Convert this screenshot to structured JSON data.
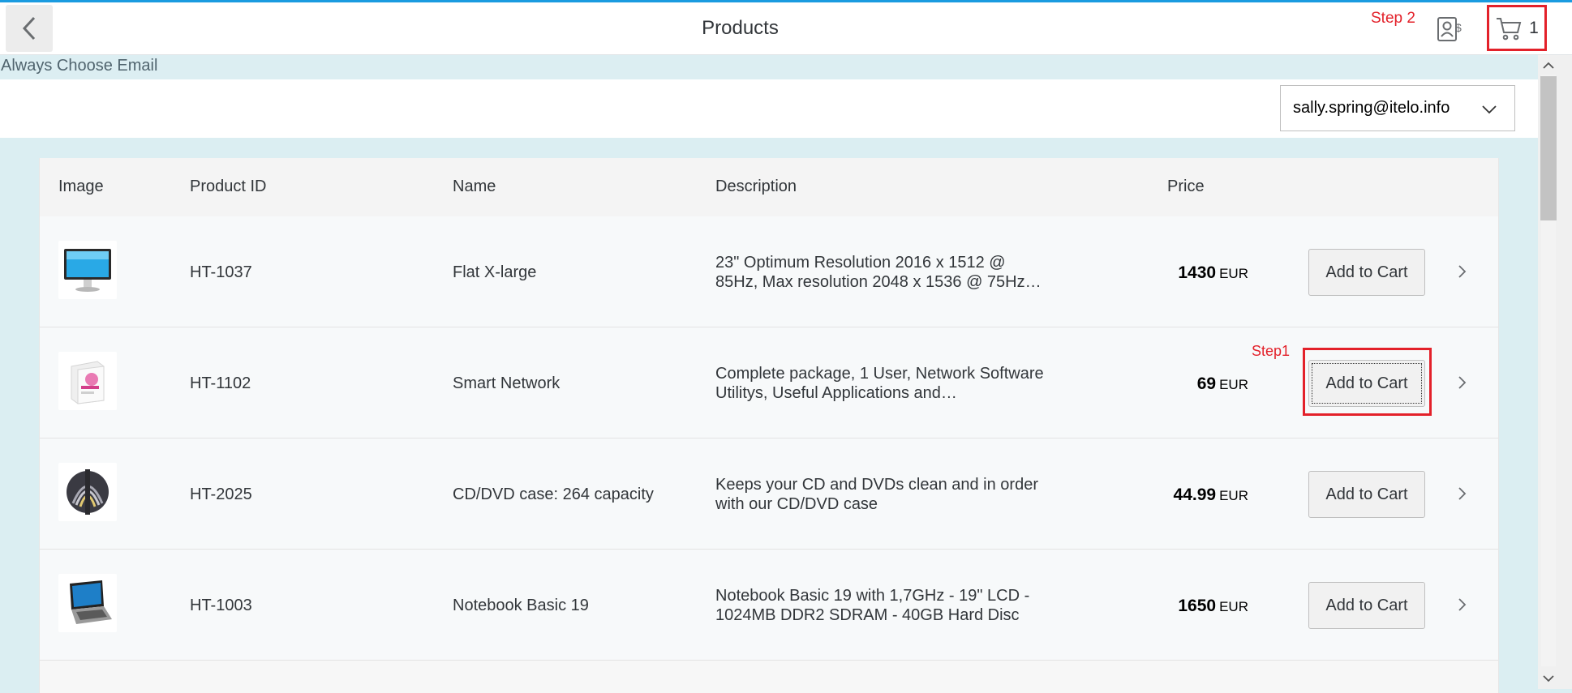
{
  "header": {
    "title": "Products",
    "cart_count": "1",
    "step2_label": "Step 2"
  },
  "subheader": {
    "text": "Always Choose Email"
  },
  "email_select": {
    "value": "sally.spring@itelo.info"
  },
  "table": {
    "columns": [
      "Image",
      "Product ID",
      "Name",
      "Description",
      "Price"
    ],
    "rows": [
      {
        "id": "HT-1037",
        "name": "Flat X-large",
        "desc_line1": "23\" Optimum Resolution 2016 x 1512 @",
        "desc_line2": "85Hz, Max resolution 2048 x 1536 @ 75Hz…",
        "price": "1430",
        "currency": "EUR",
        "button": "Add to Cart",
        "image": "monitor-image"
      },
      {
        "id": "HT-1102",
        "name": "Smart Network",
        "desc_line1": "Complete package, 1 User, Network Software",
        "desc_line2": "Utilitys, Useful Applications and…",
        "price": "69",
        "currency": "EUR",
        "button": "Add to Cart",
        "image": "software-box-image"
      },
      {
        "id": "HT-2025",
        "name": "CD/DVD case: 264 capacity",
        "desc_line1": "Keeps your CD and DVDs clean and in order",
        "desc_line2": "with our CD/DVD case",
        "price": "44.99",
        "currency": "EUR",
        "button": "Add to Cart",
        "image": "cd-case-image"
      },
      {
        "id": "HT-1003",
        "name": "Notebook Basic 19",
        "desc_line1": "Notebook Basic 19 with 1,7GHz - 19\" LCD -",
        "desc_line2": "1024MB DDR2 SDRAM - 40GB Hard Disc",
        "price": "1650",
        "currency": "EUR",
        "button": "Add to Cart",
        "image": "laptop-image"
      }
    ]
  },
  "annotations": {
    "step1_label": "Step1"
  },
  "colors": {
    "accent": "#1a9be0",
    "annotation_red": "#e3212a"
  }
}
